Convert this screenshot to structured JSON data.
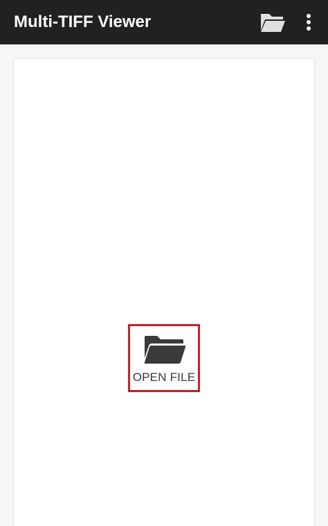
{
  "app": {
    "title": "Multi-TIFF Viewer"
  },
  "toolbar": {
    "actions": [
      {
        "icon": "folder-icon"
      },
      {
        "icon": "more-vert-icon"
      }
    ]
  },
  "main": {
    "open_file": {
      "label": "OPEN FILE",
      "icon": "folder-icon",
      "highlight_color": "#c8202a"
    }
  },
  "colors": {
    "toolbar_bg": "#212121",
    "toolbar_text": "#ffffff",
    "icon_light": "#e0e0e0",
    "icon_dark": "#3a3a3a"
  }
}
